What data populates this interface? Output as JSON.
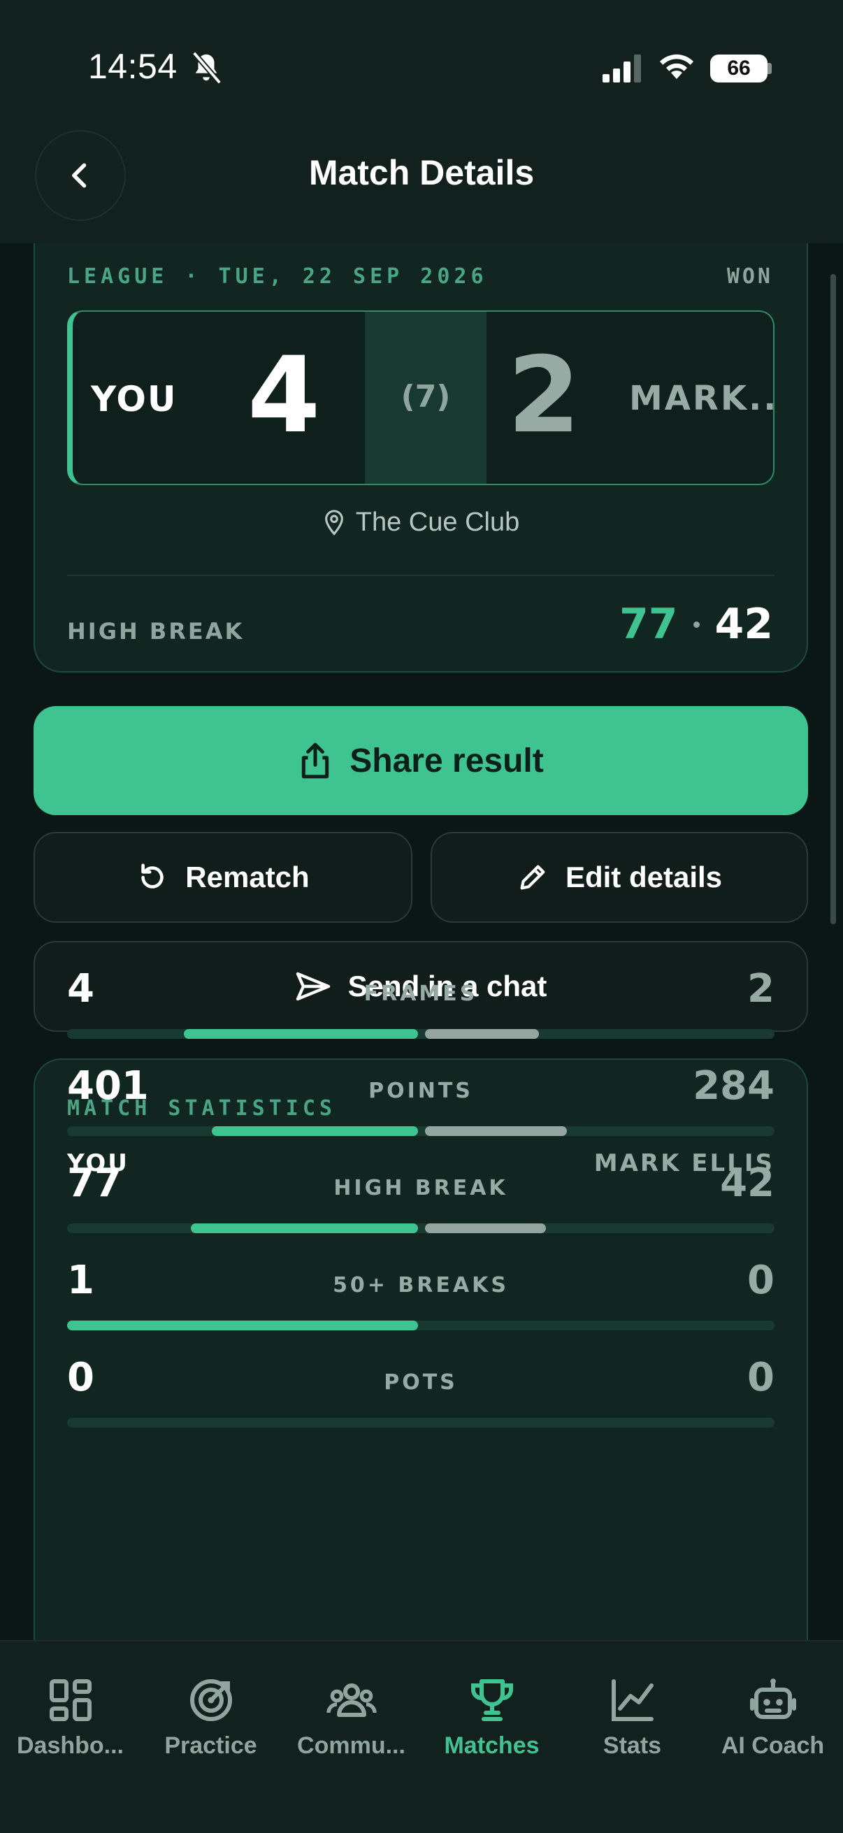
{
  "status_bar": {
    "time": "14:54",
    "battery": "66"
  },
  "header": {
    "title": "Match Details"
  },
  "match": {
    "meta": "LEAGUE · TUE, 22 SEP 2026",
    "result": "WON",
    "player": "YOU",
    "player_score": "4",
    "frames_total": "(7)",
    "opponent_score": "2",
    "opponent_short": "MARK...",
    "venue": "The Cue Club",
    "high_break_label": "HIGH BREAK",
    "high_break_you": "77",
    "high_break_opp": "42"
  },
  "actions": {
    "share": "Share result",
    "rematch": "Rematch",
    "edit": "Edit details",
    "send": "Send in a chat"
  },
  "stats": {
    "title": "MATCH STATISTICS",
    "you": "YOU",
    "opponent": "MARK ELLIS",
    "rows": [
      {
        "label": "FRAMES",
        "you": "4",
        "opp": "2",
        "you_share": 0.67,
        "opp_share": 0.33
      },
      {
        "label": "POINTS",
        "you": "401",
        "opp": "284",
        "you_share": 0.59,
        "opp_share": 0.41
      },
      {
        "label": "HIGH BREAK",
        "you": "77",
        "opp": "42",
        "you_share": 0.65,
        "opp_share": 0.35
      },
      {
        "label": "50+ BREAKS",
        "you": "1",
        "opp": "0",
        "you_share": 1.0,
        "opp_share": 0.0
      },
      {
        "label": "POTS",
        "you": "0",
        "opp": "0",
        "you_share": 0.0,
        "opp_share": 0.0
      }
    ]
  },
  "tabs": [
    {
      "label": "Dashbo...",
      "icon": "dashboard-icon"
    },
    {
      "label": "Practice",
      "icon": "target-icon"
    },
    {
      "label": "Commu...",
      "icon": "community-icon"
    },
    {
      "label": "Matches",
      "icon": "trophy-icon",
      "active": true
    },
    {
      "label": "Stats",
      "icon": "chart-icon"
    },
    {
      "label": "AI Coach",
      "icon": "robot-icon"
    }
  ],
  "colors": {
    "accent": "#3ec391",
    "background": "#0b1715",
    "card": "#112521",
    "muted": "#97aaa3"
  }
}
